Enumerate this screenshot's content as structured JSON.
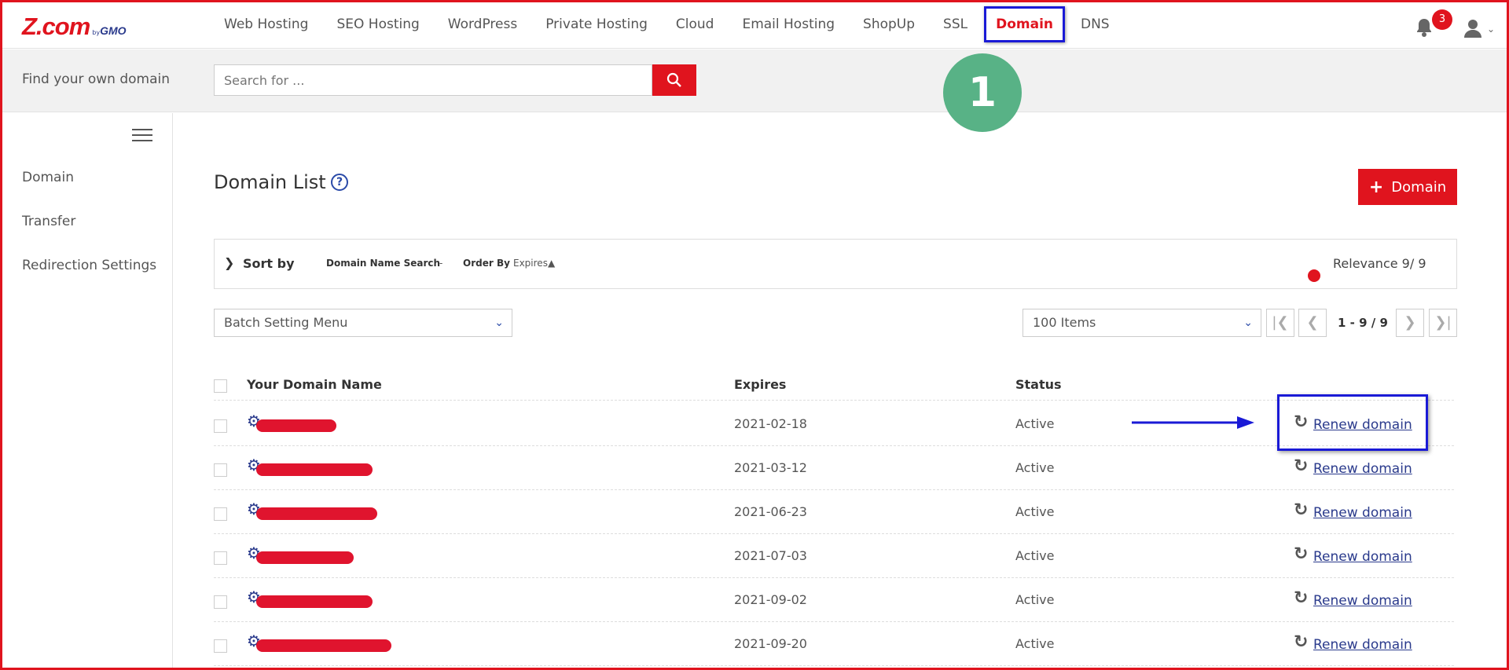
{
  "brand": {
    "name": "Z.com",
    "by": "by",
    "gmo": "GMO"
  },
  "nav": {
    "items": [
      "Web Hosting",
      "SEO Hosting",
      "WordPress",
      "Private Hosting",
      "Cloud",
      "Email Hosting",
      "ShopUp",
      "SSL",
      "Domain",
      "DNS"
    ],
    "active": "Domain",
    "notification_count": "3"
  },
  "search": {
    "label": "Find your own domain",
    "placeholder": "Search for ..."
  },
  "step_marker": "1",
  "sidebar": {
    "items": [
      "Domain",
      "Transfer",
      "Redirection Settings"
    ]
  },
  "main": {
    "title": "Domain List",
    "help": "?",
    "add_button": "Domain",
    "sort": {
      "label": "Sort by",
      "field": "Domain Name Search",
      "dash": "-",
      "order_label": "Order By",
      "order_value": "Expires▲"
    },
    "relevance": "Relevance 9/ 9",
    "batch_menu": "Batch Setting Menu",
    "items_per_page": "100 Items",
    "pagination": "1 - 9 / 9",
    "columns": {
      "name": "Your Domain Name",
      "expires": "Expires",
      "status": "Status"
    },
    "rows": [
      {
        "expires": "2021-02-18",
        "status": "Active",
        "action": "Renew domain"
      },
      {
        "expires": "2021-03-12",
        "status": "Active",
        "action": "Renew domain"
      },
      {
        "expires": "2021-06-23",
        "status": "Active",
        "action": "Renew domain"
      },
      {
        "expires": "2021-07-03",
        "status": "Active",
        "action": "Renew domain"
      },
      {
        "expires": "2021-09-02",
        "status": "Active",
        "action": "Renew domain"
      },
      {
        "expires": "2021-09-20",
        "status": "Active",
        "action": "Renew domain"
      }
    ]
  },
  "colors": {
    "brand_red": "#e0141e",
    "highlight_blue": "#1a1ad6",
    "step_green": "#58b286",
    "link_blue": "#2a3a8c"
  }
}
